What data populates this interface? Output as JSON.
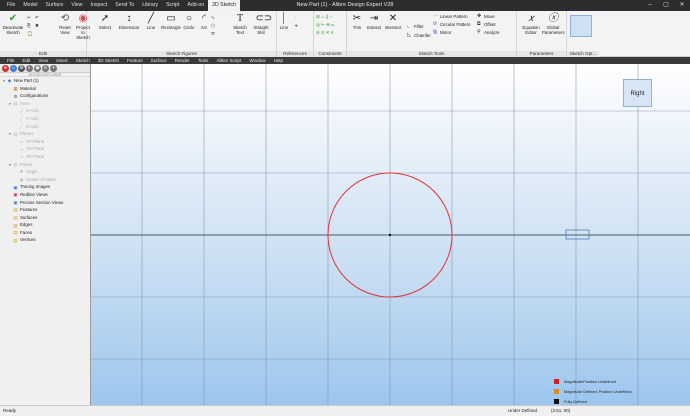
{
  "window": {
    "title": "New Part (1) - Alibre Design Expert V28",
    "tabs": [
      "File",
      "Model",
      "Surface",
      "View",
      "Inspect",
      "Send To",
      "Library",
      "Script",
      "Add-on",
      "2D Sketch"
    ],
    "active_tab_index": 9
  },
  "ribbon": {
    "groups": {
      "edit": "Edit",
      "sketch_figures": "Sketch Figures",
      "references": "References",
      "constraints": "Constraints",
      "sketch_tools": "Sketch Tools",
      "parameters": "Parameters",
      "sketch_options": "Sketch Opt..."
    },
    "buttons": {
      "deactivate_sketch": "Deactivate Sketch",
      "reset_view": "Reset View",
      "project_to_sketch": "Project to Sketch",
      "select": "Select",
      "dimension": "Dimension",
      "line": "Line",
      "rectangle": "Rectangle",
      "circle": "Circle",
      "arc": "Arc",
      "sketch_text": "Sketch Text",
      "straight_slot": "Straight Slot",
      "ref_line": "Line",
      "trim": "Trim",
      "extend": "Extend",
      "intersect": "Intersect",
      "fillet": "Fillet",
      "chamfer": "Chamfer",
      "linear_pattern": "Linear Pattern",
      "circular_pattern": "Circular Pattern",
      "mirror": "Mirror",
      "move": "Move",
      "offset": "Offset",
      "analyze": "Analyze",
      "equation_editor": "Equation Editor",
      "global_parameters": "Global Parameters"
    }
  },
  "menubar": [
    "File",
    "Edit",
    "View",
    "Insert",
    "Sketch",
    "3D Sketch",
    "Feature",
    "Surface",
    "Render",
    "Tools",
    "Alibre Script",
    "Window",
    "Help"
  ],
  "panel": {
    "header": "DESIGN EXPLORER",
    "items": [
      {
        "label": "New Part (1)",
        "icon": "part-icon",
        "dim": false
      },
      {
        "label": "Material",
        "icon": "material-icon",
        "dim": false
      },
      {
        "label": "Configurations",
        "icon": "configurations-icon",
        "dim": false
      },
      {
        "label": "Axes",
        "icon": "axes-folder-icon",
        "dim": true
      },
      {
        "label": "X-Axis",
        "icon": "axis-icon",
        "dim": true
      },
      {
        "label": "Y-Axis",
        "icon": "axis-icon",
        "dim": true
      },
      {
        "label": "Z-Axis",
        "icon": "axis-icon",
        "dim": true
      },
      {
        "label": "Planes",
        "icon": "planes-folder-icon",
        "dim": true
      },
      {
        "label": "XY-Plane",
        "icon": "plane-icon",
        "dim": true
      },
      {
        "label": "YZ-Plane",
        "icon": "plane-icon",
        "dim": true
      },
      {
        "label": "ZX-Plane",
        "icon": "plane-icon",
        "dim": true
      },
      {
        "label": "Points",
        "icon": "points-folder-icon",
        "dim": true
      },
      {
        "label": "Origin",
        "icon": "origin-icon",
        "dim": true
      },
      {
        "label": "Center of Mass",
        "icon": "center-of-mass-icon",
        "dim": true
      },
      {
        "label": "Tracing Images",
        "icon": "tracing-images-icon",
        "dim": false
      },
      {
        "label": "Redline Views",
        "icon": "redline-views-icon",
        "dim": false
      },
      {
        "label": "Precise Section Views",
        "icon": "section-views-icon",
        "dim": false
      },
      {
        "label": "Features",
        "icon": "features-icon",
        "dim": false
      },
      {
        "label": "Surfaces",
        "icon": "surfaces-icon",
        "dim": false
      },
      {
        "label": "Edges",
        "icon": "edges-icon",
        "dim": false
      },
      {
        "label": "Faces",
        "icon": "faces-icon",
        "dim": false
      },
      {
        "label": "Vertices",
        "icon": "vertices-icon",
        "dim": false
      }
    ]
  },
  "viewport": {
    "view_label": "Right",
    "legend": [
      {
        "label": "Magnitude/Position Undefined",
        "color": "#d42020"
      },
      {
        "label": "Magnitude Defined, Position Undefined",
        "color": "#e08a1c"
      },
      {
        "label": "Fully Defined",
        "color": "#111111"
      }
    ]
  },
  "statusbar": {
    "left": "Ready",
    "middle": "Under Defined",
    "coords": "(3.61, 00)"
  },
  "colors": {
    "sketch_circle": "#e0333c",
    "grid_line": "#7c8ea4",
    "accent": "#2b6cc4"
  }
}
